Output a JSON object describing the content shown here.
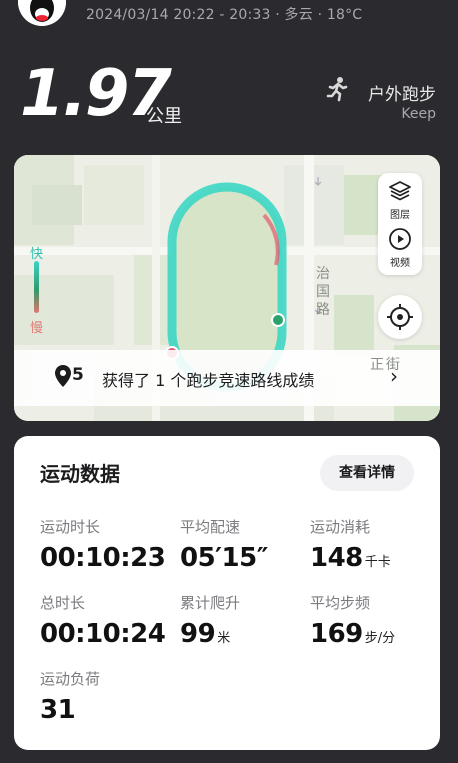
{
  "header": {
    "meta": "2024/03/14 20:22 - 20:33 · 多云 · 18°C",
    "distance": "1.97",
    "distance_unit": "公里",
    "sport_type": "户外跑步",
    "source": "Keep",
    "sport_icon": "running-person-icon"
  },
  "map": {
    "speed_fast": "快",
    "speed_slow": "慢",
    "tools": [
      {
        "label": "图层",
        "icon": "layers-icon"
      },
      {
        "label": "视频",
        "icon": "play-video-icon"
      }
    ],
    "locate_icon": "locate-icon",
    "road_labels": [
      "治",
      "国",
      "路",
      "正",
      "街"
    ],
    "route_badge_count": "5",
    "route_message": "获得了 1 个跑步竞速路线成绩",
    "colors": {
      "track_start": "#e6586e",
      "track_end": "#2aa36a",
      "track_line": "#3dd6c4"
    }
  },
  "stats": {
    "title": "运动数据",
    "detail_button": "查看详情",
    "items": [
      {
        "label": "运动时长",
        "value": "00:10:23",
        "unit": ""
      },
      {
        "label": "平均配速",
        "value": "05′15″",
        "unit": ""
      },
      {
        "label": "运动消耗",
        "value": "148",
        "unit": "千卡"
      },
      {
        "label": "总时长",
        "value": "00:10:24",
        "unit": ""
      },
      {
        "label": "累计爬升",
        "value": "99",
        "unit": "米"
      },
      {
        "label": "平均步频",
        "value": "169",
        "unit": "步/分"
      },
      {
        "label": "运动负荷",
        "value": "31",
        "unit": ""
      }
    ]
  }
}
